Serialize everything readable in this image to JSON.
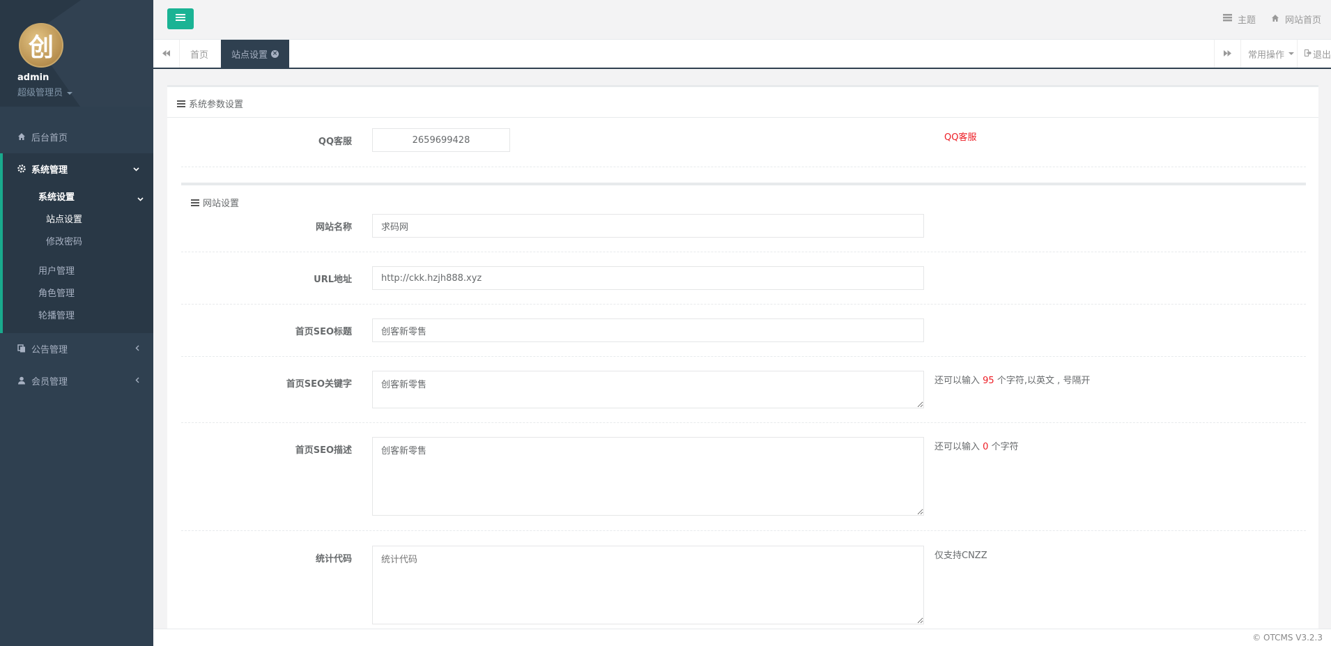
{
  "profile": {
    "name": "admin",
    "role": "超级管理员",
    "avatar_char": "创"
  },
  "sidebar": {
    "home": "后台首页",
    "system": "系统管理",
    "system_settings": "系统设置",
    "site_settings": "站点设置",
    "change_password": "修改密码",
    "user_mgmt": "用户管理",
    "role_mgmt": "角色管理",
    "carousel_mgmt": "轮播管理",
    "notice_mgmt": "公告管理",
    "member_mgmt": "会员管理"
  },
  "topbar": {
    "theme": "主题",
    "site_home": "网站首页"
  },
  "tabs": {
    "home": "首页",
    "site_settings": "站点设置",
    "common_ops": "常用操作",
    "logout": "退出"
  },
  "panel": {
    "title": "系统参数设置",
    "qq_label": "QQ客服",
    "qq_value": "2659699428",
    "qq_hint": "QQ客服",
    "section_title": "网站设置",
    "site_name_label": "网站名称",
    "site_name_value": "求码网",
    "url_label": "URL地址",
    "url_value": "http://ckk.hzjh888.xyz",
    "seo_title_label": "首页SEO标题",
    "seo_title_value": "创客新零售",
    "seo_keywords_label": "首页SEO关键字",
    "seo_keywords_value": "创客新零售",
    "seo_keywords_hint_pre": "还可以输入",
    "seo_keywords_remaining": "95",
    "seo_keywords_hint_post": "个字符,以英文 , 号隔开",
    "seo_desc_label": "首页SEO描述",
    "seo_desc_value": "创客新零售",
    "seo_desc_hint_pre": "还可以输入",
    "seo_desc_remaining": "0",
    "seo_desc_hint_post": "个字符",
    "stats_label": "统计代码",
    "stats_placeholder": "统计代码",
    "stats_hint": "仅支持CNZZ"
  },
  "footer": "© OTCMS V3.2.3",
  "colors": {
    "sidebar": "#2f4050",
    "accent": "#1ab394",
    "hint_red": "#ed1c24"
  }
}
